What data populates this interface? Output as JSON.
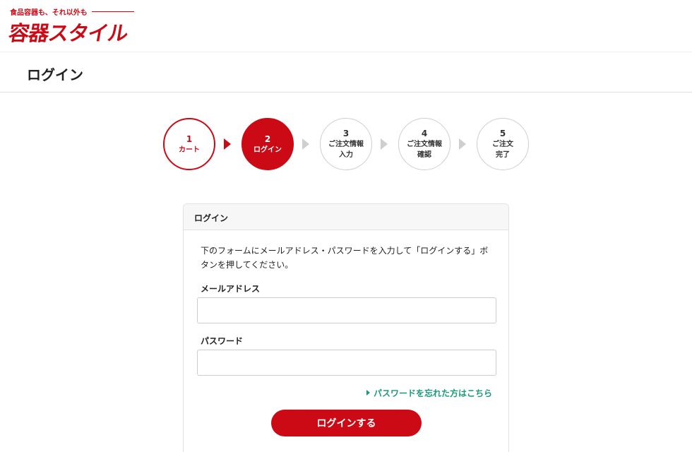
{
  "header": {
    "logo_tagline": "食品容器も、それ以外も",
    "logo_text": "容器スタイル"
  },
  "page": {
    "title": "ログイン"
  },
  "steps": [
    {
      "num": "1",
      "label": "カート",
      "state": "done"
    },
    {
      "num": "2",
      "label": "ログイン",
      "state": "current"
    },
    {
      "num": "3",
      "label": "ご注文情報\n入力",
      "state": "todo"
    },
    {
      "num": "4",
      "label": "ご注文情報\n確認",
      "state": "todo"
    },
    {
      "num": "5",
      "label": "ご注文\n完了",
      "state": "todo"
    }
  ],
  "login_panel": {
    "title": "ログイン",
    "intro": "下のフォームにメールアドレス・パスワードを入力して「ログインする」ボタンを押してください。",
    "email_label": "メールアドレス",
    "email_value": "",
    "password_label": "パスワード",
    "password_value": "",
    "forgot_link": "パスワードを忘れた方はこちら",
    "submit_label": "ログインする"
  },
  "colors": {
    "brand_red": "#cc0a16",
    "link_green": "#1a9a7a",
    "inactive_grey": "#cfcfcf"
  },
  "icons": {
    "step_arrow": "triangle-right-icon",
    "link_marker": "triangle-right-icon"
  }
}
